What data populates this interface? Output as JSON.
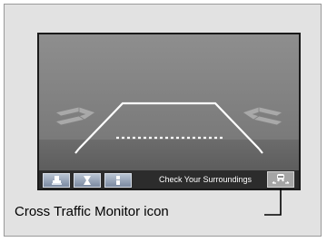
{
  "camera_view": {
    "status_message": "Check Your Surroundings",
    "view_mode_buttons": [
      {
        "icon": "top-down-view-icon"
      },
      {
        "icon": "wide-view-icon"
      },
      {
        "icon": "normal-view-icon"
      }
    ],
    "cross_traffic_icon": "cross-traffic-monitor-icon"
  },
  "caption": {
    "label": "Cross Traffic Monitor icon"
  },
  "colors": {
    "button_fill": "#7b8aa1",
    "guide_line": "#ffffff",
    "arrow": "#a8a8a8"
  }
}
